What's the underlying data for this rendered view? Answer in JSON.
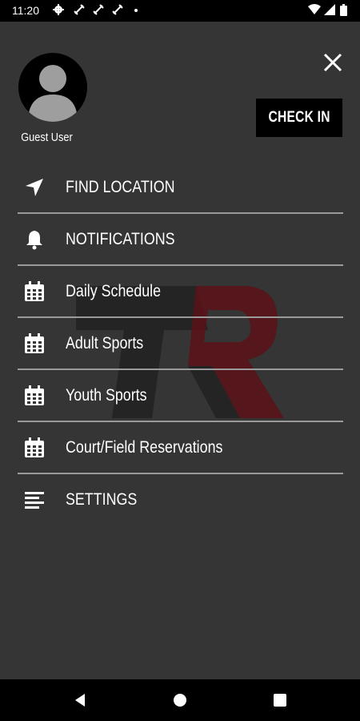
{
  "status_bar": {
    "time": "11:20",
    "icons": [
      "gear-icon",
      "satellite-icon",
      "satellite-icon",
      "satellite-icon",
      "dot-icon",
      "wifi-icon",
      "signal-icon",
      "battery-icon"
    ]
  },
  "drawer": {
    "close_icon": "close-icon",
    "user": {
      "name": "Guest User",
      "avatar_icon": "user-avatar-icon"
    },
    "check_in_label": "CHECK IN",
    "menu": [
      {
        "label": "FIND LOCATION",
        "icon": "navigation-arrow-icon"
      },
      {
        "label": "NOTIFICATIONS",
        "icon": "bell-icon"
      },
      {
        "label": "Daily Schedule",
        "icon": "calendar-icon"
      },
      {
        "label": "Adult Sports",
        "icon": "calendar-icon"
      },
      {
        "label": "Youth Sports",
        "icon": "calendar-icon"
      },
      {
        "label": "Court/Field Reservations",
        "icon": "calendar-icon"
      },
      {
        "label": "SETTINGS",
        "icon": "settings-lines-icon"
      }
    ]
  },
  "colors": {
    "background": "#353535",
    "button": "#000000",
    "divider": "#9a9a9a",
    "watermark_dark": "#222222",
    "watermark_red": "#5a1216"
  },
  "nav_bar": {
    "icons": [
      "back-icon",
      "home-icon",
      "recents-icon"
    ]
  }
}
